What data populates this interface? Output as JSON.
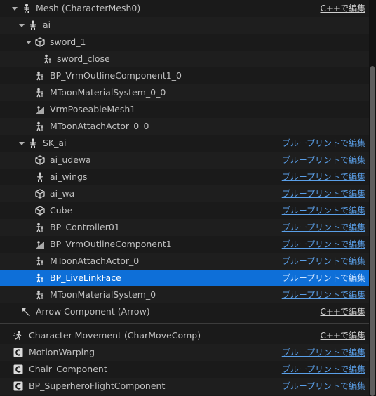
{
  "accent": "#0e6fd8",
  "rows": [
    {
      "label": "Mesh (CharacterMesh0)",
      "icon": "skeleton-icon",
      "edit": "C++で編集",
      "edit_type": "cpp"
    },
    {
      "label": "ai",
      "icon": "skeleton-icon",
      "edit": "",
      "edit_type": ""
    },
    {
      "label": "sword_1",
      "icon": "cube-icon",
      "edit": "",
      "edit_type": ""
    },
    {
      "label": "sword_close",
      "icon": "figure-icon",
      "edit": "",
      "edit_type": ""
    },
    {
      "label": "BP_VrmOutlineComponent1_0",
      "icon": "figure-icon",
      "edit": "",
      "edit_type": ""
    },
    {
      "label": "MToonMaterialSystem_0_0",
      "icon": "figure-icon",
      "edit": "",
      "edit_type": ""
    },
    {
      "label": "VrmPoseableMesh1",
      "icon": "poseable-mesh-icon",
      "edit": "",
      "edit_type": ""
    },
    {
      "label": "MToonAttachActor_0_0",
      "icon": "figure-icon",
      "edit": "",
      "edit_type": ""
    },
    {
      "label": "SK_ai",
      "icon": "skeleton-icon",
      "edit": "ブループリントで編集",
      "edit_type": "bp"
    },
    {
      "label": "ai_udewa",
      "icon": "cube-icon",
      "edit": "ブループリントで編集",
      "edit_type": "bp"
    },
    {
      "label": "ai_wings",
      "icon": "skeleton-icon",
      "edit": "ブループリントで編集",
      "edit_type": "bp"
    },
    {
      "label": "ai_wa",
      "icon": "cube-icon",
      "edit": "ブループリントで編集",
      "edit_type": "bp"
    },
    {
      "label": "Cube",
      "icon": "cube-icon",
      "edit": "ブループリントで編集",
      "edit_type": "bp"
    },
    {
      "label": "BP_Controller01",
      "icon": "figure-icon",
      "edit": "ブループリントで編集",
      "edit_type": "bp"
    },
    {
      "label": "BP_VrmOutlineComponent1",
      "icon": "poseable-mesh-icon",
      "edit": "ブループリントで編集",
      "edit_type": "bp"
    },
    {
      "label": "MToonAttachActor_0",
      "icon": "figure-icon",
      "edit": "ブループリントで編集",
      "edit_type": "bp"
    },
    {
      "label": "BP_LiveLinkFace",
      "icon": "figure-icon",
      "edit": "ブループリントで編集",
      "edit_type": "bp",
      "selected": true
    },
    {
      "label": "MToonMaterialSystem_0",
      "icon": "figure-icon",
      "edit": "ブループリントで編集",
      "edit_type": "bp"
    },
    {
      "label": "Arrow Component (Arrow)",
      "icon": "arrow-icon",
      "edit": "C++で編集",
      "edit_type": "cpp"
    },
    {
      "label": "Character Movement (CharMoveComp)",
      "icon": "movement-icon",
      "edit": "C++で編集",
      "edit_type": "cpp"
    },
    {
      "label": "MotionWarping",
      "icon": "component-icon",
      "edit": "ブループリントで編集",
      "edit_type": "bp"
    },
    {
      "label": "Chair_Component",
      "icon": "component-icon",
      "edit": "ブループリントで編集",
      "edit_type": "bp"
    },
    {
      "label": "BP_SuperheroFlightComponent",
      "icon": "component-icon",
      "edit": "ブループリントで編集",
      "edit_type": "bp"
    }
  ]
}
